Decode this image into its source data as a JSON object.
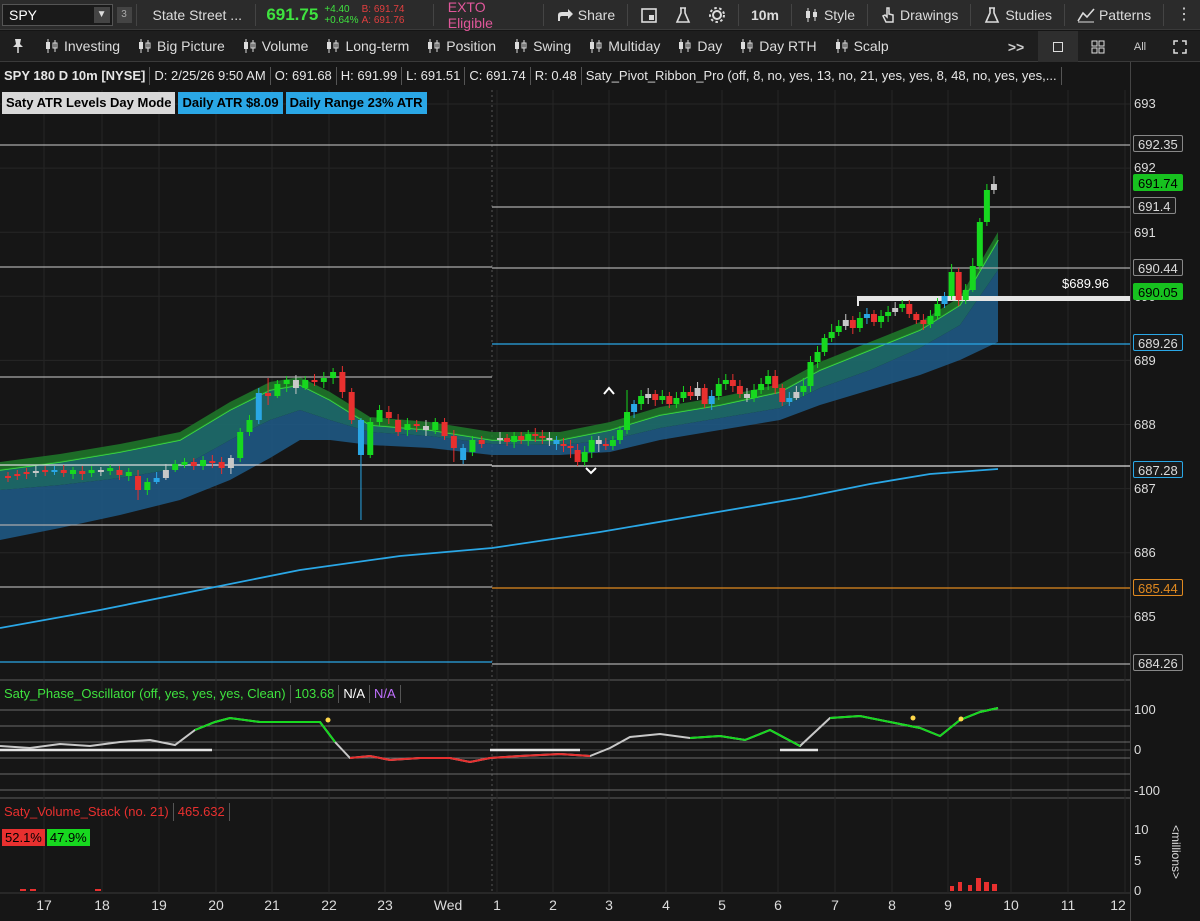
{
  "toolbar": {
    "symbol": "SPY",
    "badge_num": "3",
    "company": "State Street ...",
    "last": "691.75",
    "change": "+4.40",
    "change_pct": "+0.64%",
    "bid": "B: 691.74",
    "ask": "A: 691.76",
    "exto": "EXTO Eligible",
    "share": "Share",
    "timeframe": "10m",
    "style": "Style",
    "drawings": "Drawings",
    "studies": "Studies",
    "patterns": "Patterns"
  },
  "modes": [
    "Investing",
    "Big Picture",
    "Volume",
    "Long-term",
    "Position",
    "Swing",
    "Multiday",
    "Day",
    "Day RTH",
    "Scalp"
  ],
  "modes_more": ">>",
  "grid_all": "All",
  "info": {
    "title": "SPY 180 D 10m [NYSE]",
    "date": "D: 2/25/26 9:50 AM",
    "open": "O: 691.68",
    "high": "H: 691.99",
    "low": "L: 691.51",
    "close": "C: 691.74",
    "range": "R: 0.48",
    "study": "Saty_Pivot_Ribbon_Pro (off, 8, no, yes, 13, no, 21, yes, yes, 8, 48, no, yes, yes,..."
  },
  "badges": {
    "mode": "Saty ATR Levels Day Mode",
    "atr": "Daily ATR $8.09",
    "range": "Daily Range 23% ATR"
  },
  "annotation": "$689.96",
  "price_axis": {
    "ticks": [
      "693",
      "692",
      "691",
      "690",
      "689",
      "688",
      "687",
      "686",
      "685"
    ],
    "tags": [
      {
        "label": "692.35",
        "bg": "#1a1a1a",
        "fg": "#dcdcdc",
        "border": "#888"
      },
      {
        "label": "691.74",
        "bg": "#17c11f",
        "fg": "#000000",
        "border": "#17c11f"
      },
      {
        "label": "691.4",
        "bg": "#1a1a1a",
        "fg": "#dcdcdc",
        "border": "#888"
      },
      {
        "label": "690.44",
        "bg": "#1a1a1a",
        "fg": "#dcdcdc",
        "border": "#888"
      },
      {
        "label": "690.05",
        "bg": "#17c11f",
        "fg": "#000000",
        "border": "#17c11f"
      },
      {
        "label": "689.26",
        "bg": "#1a1a1a",
        "fg": "#dcdcdc",
        "border": "#2aa7e6"
      },
      {
        "label": "687.28",
        "bg": "#1a1a1a",
        "fg": "#dcdcdc",
        "border": "#2aa7e6"
      },
      {
        "label": "685.44",
        "bg": "#1a1a1a",
        "fg": "#e0891f",
        "border": "#e0891f"
      },
      {
        "label": "684.26",
        "bg": "#1a1a1a",
        "fg": "#dcdcdc",
        "border": "#888"
      }
    ]
  },
  "oscillator": {
    "name": "Saty_Phase_Oscillator (off, yes, yes, yes, Clean)",
    "value": "103.68",
    "na1": "N/A",
    "na2": "N/A",
    "ticks": [
      "100",
      "0",
      "-100"
    ]
  },
  "volume": {
    "name": "Saty_Volume_Stack (no. 21)",
    "value": "465.632",
    "sell_pct": "52.1%",
    "buy_pct": "47.9%",
    "ticks": [
      "10",
      "5",
      "0"
    ],
    "unit": "<millions>"
  },
  "x_axis": [
    "17",
    "18",
    "19",
    "20",
    "21",
    "22",
    "23",
    "Wed",
    "1",
    "2",
    "3",
    "4",
    "5",
    "6",
    "7",
    "8",
    "9",
    "10",
    "11",
    "12"
  ],
  "colors": {
    "up": "#17d81f",
    "down": "#e8302f",
    "neutral": "#c8c8c8",
    "blue": "#2aa7e6",
    "orange": "#e0891f",
    "ribbon_green": "#1e7a2a",
    "ribbon_teal": "#1d6d6d",
    "ribbon_blue": "#1f5c8a"
  }
}
